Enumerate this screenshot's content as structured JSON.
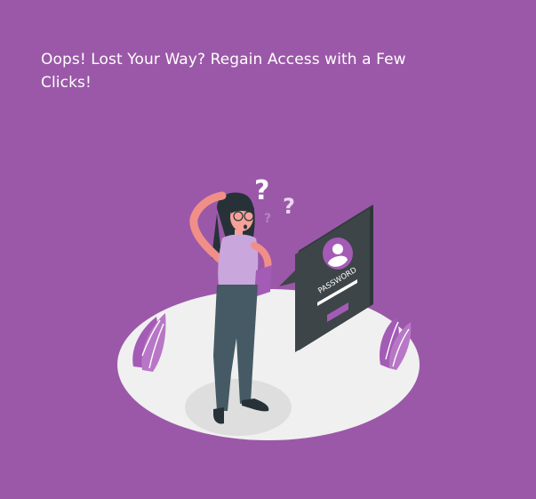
{
  "page": {
    "headline": "Oops! Lost Your Way? Regain Access with a Few Clicks!"
  },
  "illustration": {
    "card_label": "PASSWORD",
    "question_marks": [
      "?",
      "?",
      "?"
    ],
    "subject": "confused-woman-with-phone"
  },
  "colors": {
    "background": "#9b58a8",
    "accent": "#a35bb5",
    "card": "#3d4548",
    "platform": "#f0f0f0",
    "text": "#ffffff"
  }
}
